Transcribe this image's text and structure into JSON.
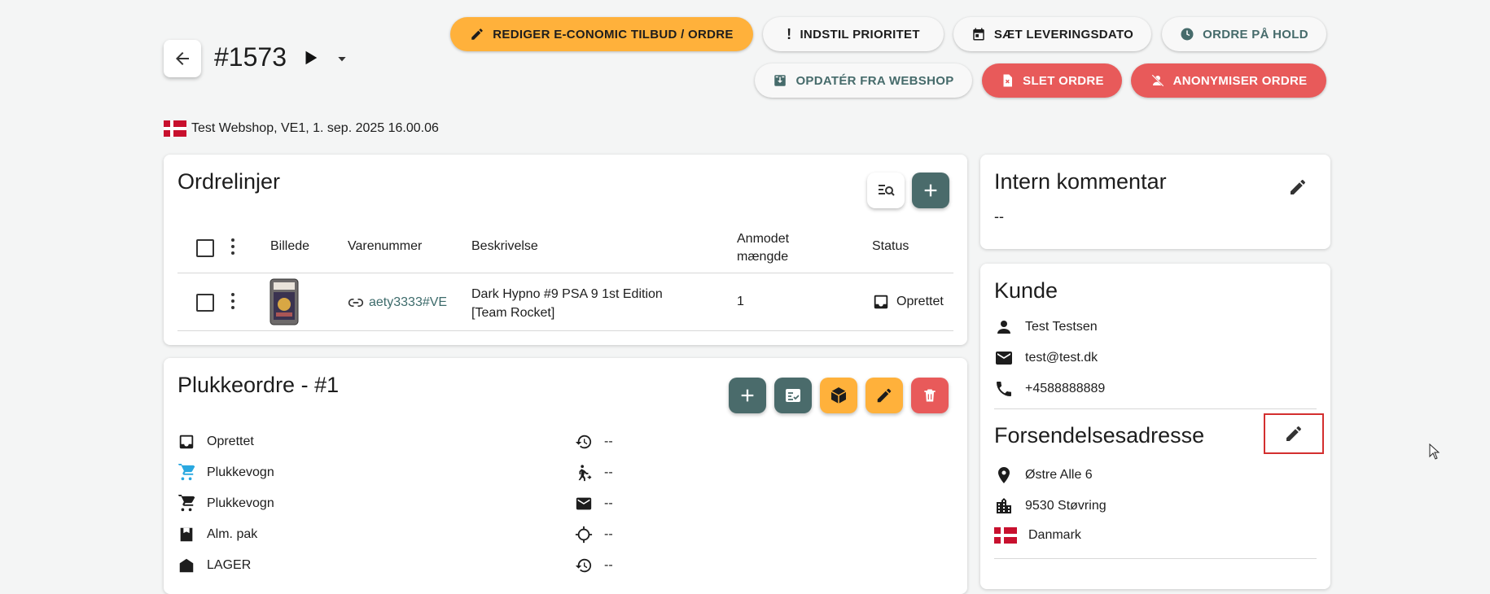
{
  "header": {
    "order_number": "#1573",
    "buttons": {
      "edit_economic": "REDIGER E-CONOMIC TILBUD / ORDRE",
      "set_priority": "INDSTIL PRIORITET",
      "set_delivery_date": "SÆT LEVERINGSDATO",
      "order_on_hold": "ORDRE PÅ HOLD",
      "update_from_webshop": "OPDATÉR FRA WEBSHOP",
      "delete_order": "SLET ORDRE",
      "anonymize_order": "ANONYMISER ORDRE"
    },
    "source_line": "Test Webshop, VE1, 1. sep. 2025 16.00.06"
  },
  "order_lines": {
    "title": "Ordrelinjer",
    "columns": {
      "image": "Billede",
      "item_number": "Varenummer",
      "description": "Beskrivelse",
      "requested_qty_line1": "Anmodet",
      "requested_qty_line2": "mængde",
      "status": "Status"
    },
    "rows": [
      {
        "item_number": "aety3333#VE",
        "description_line1": "Dark Hypno #9 PSA 9 1st Edition",
        "description_line2": "[Team Rocket]",
        "qty": "1",
        "status": "Oprettet"
      }
    ]
  },
  "pick_order": {
    "title": "Plukkeordre - #1",
    "left_items": [
      "Oprettet",
      "Plukkevogn",
      "Plukkevogn",
      "Alm. pak",
      "LAGER"
    ],
    "right_items": [
      "--",
      "--",
      "--",
      "--",
      "--"
    ]
  },
  "internal_comment": {
    "title": "Intern kommentar",
    "value": "--"
  },
  "customer": {
    "title": "Kunde",
    "name": "Test Testsen",
    "email": "test@test.dk",
    "phone": "+4588888889"
  },
  "shipping_address": {
    "title": "Forsendelsesadresse",
    "street": "Østre Alle 6",
    "city": "9530 Støvring",
    "country": "Danmark"
  },
  "colors": {
    "accent_orange": "#ffb13b",
    "teal": "#4a6b6b",
    "danger": "#e85a5a",
    "link": "#3d6b6b",
    "highlight_border": "#d32f2f"
  }
}
